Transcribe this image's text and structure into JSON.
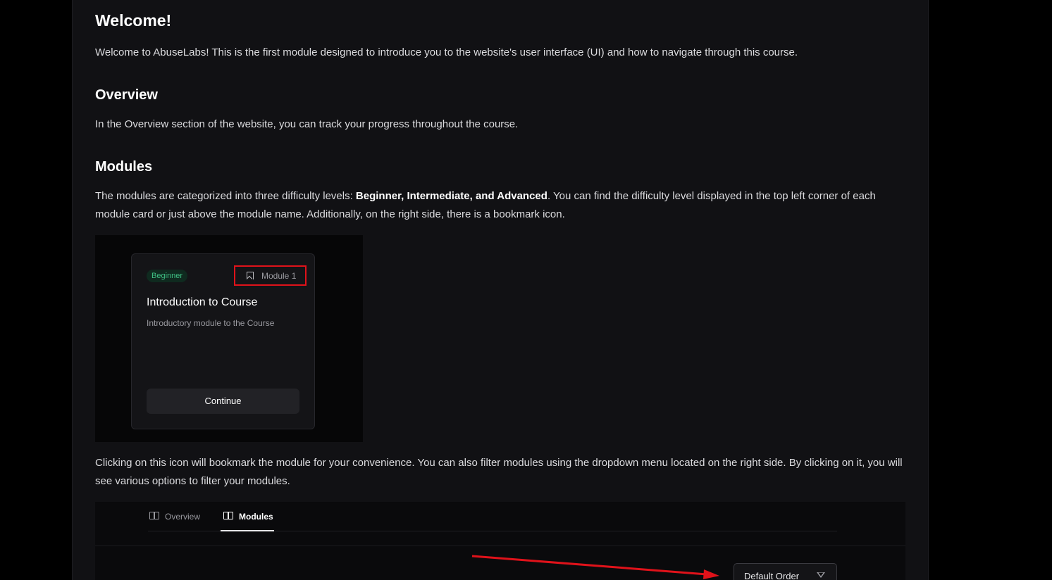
{
  "heading": "Welcome!",
  "intro": "Welcome to AbuseLabs! This is the first module designed to introduce you to the website's user interface (UI) and how to navigate through this course.",
  "overview": {
    "heading": "Overview",
    "text": "In the Overview section of the website, you can track your progress throughout the course."
  },
  "modules": {
    "heading": "Modules",
    "text_before": "The modules are categorized into three difficulty levels: ",
    "text_bold": "Beginner, Intermediate, and Advanced",
    "text_after": ". You can find the difficulty level displayed in the top left corner of each module card or just above the module name. Additionally, on the right side, there is a bookmark icon.",
    "text2": "Clicking on this icon will bookmark the module for your convenience. You can also filter modules using the dropdown menu located on the right side. By clicking on it, you will see various options to filter your modules."
  },
  "card": {
    "badge": "Beginner",
    "module_label": "Module 1",
    "title": "Introduction to Course",
    "description": "Introductory module to the Course",
    "button": "Continue"
  },
  "tabs": [
    {
      "label": "Overview",
      "icon": "book-icon",
      "active": false
    },
    {
      "label": "Modules",
      "icon": "book-icon",
      "active": true
    }
  ],
  "dropdown": {
    "label": "Default Order",
    "icon": "filter-icon"
  },
  "colors": {
    "background": "#111114",
    "badge_green": "#3fbf83",
    "highlight_red": "#e0121a"
  }
}
